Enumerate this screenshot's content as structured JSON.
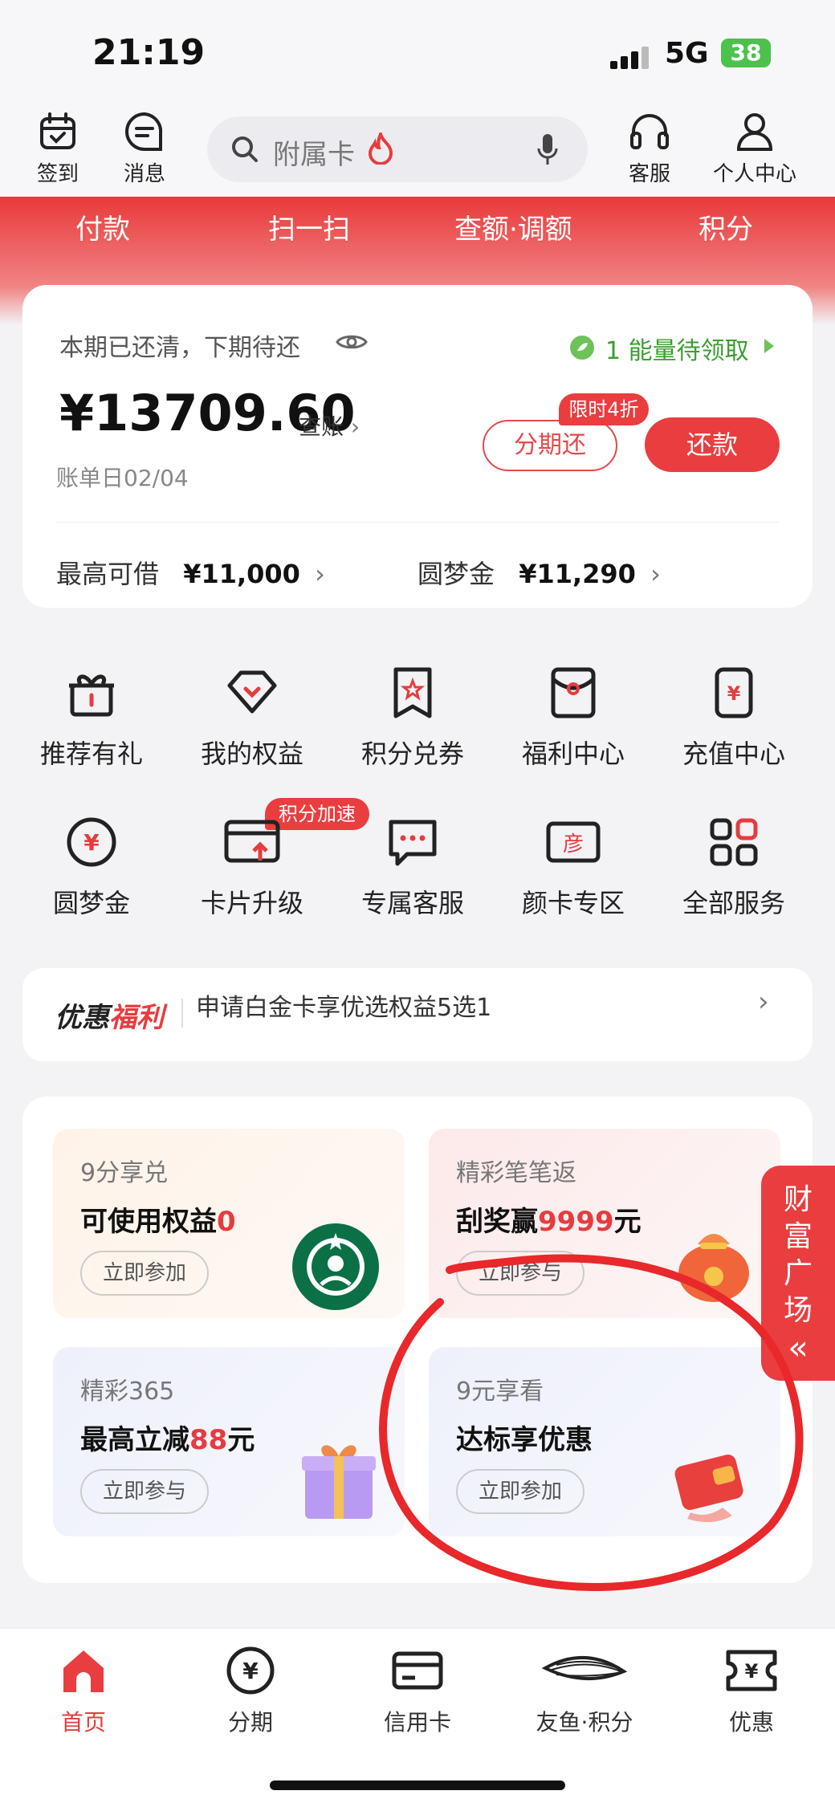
{
  "status_bar": {
    "time": "21:19",
    "network": "5G",
    "battery": "38"
  },
  "header": {
    "checkin_label": "签到",
    "message_label": "消息",
    "search_placeholder": "附属卡",
    "service_label": "客服",
    "profile_label": "个人中心"
  },
  "tabs": [
    "付款",
    "扫一扫",
    "查额·调额",
    "积分"
  ],
  "bill_card": {
    "status": "本期已还清，下期待还",
    "energy": "1 能量待领取",
    "amount": "¥13709.60",
    "view_bill": "查账",
    "bill_date": "账单日02/04",
    "installment_label": "分期还",
    "discount_badge": "限时4折",
    "repay_label": "还款",
    "max_borrow_label": "最高可借",
    "max_borrow_value": "¥11,000",
    "dream_gold_label": "圆梦金",
    "dream_gold_value": "¥11,290"
  },
  "services": [
    {
      "label": "推荐有礼",
      "icon": "gift-icon"
    },
    {
      "label": "我的权益",
      "icon": "rights-icon"
    },
    {
      "label": "积分兑券",
      "icon": "coupon-icon"
    },
    {
      "label": "福利中心",
      "icon": "welfare-icon"
    },
    {
      "label": "充值中心",
      "icon": "recharge-icon"
    },
    {
      "label": "圆梦金",
      "icon": "yen-circle-icon"
    },
    {
      "label": "卡片升级",
      "icon": "card-upgrade-icon"
    },
    {
      "label": "专属客服",
      "icon": "chat-icon"
    },
    {
      "label": "颜卡专区",
      "icon": "yan-card-icon"
    },
    {
      "label": "全部服务",
      "icon": "grid-icon"
    }
  ],
  "speed_badge": "积分加速",
  "promo": {
    "brand_black": "优惠",
    "brand_red": "福利",
    "text": "申请白金卡享优选权益5选1"
  },
  "activities": [
    {
      "sub": "9分享兑",
      "title": "可使用权益",
      "highlight": "0",
      "suffix": "",
      "button": "立即参加"
    },
    {
      "sub": "精彩笔笔返",
      "title": "刮奖赢",
      "highlight": "9999",
      "suffix": "元",
      "button": "立即参与"
    },
    {
      "sub": "精彩365",
      "title": "最高立减",
      "highlight": "88",
      "suffix": "元",
      "button": "立即参与"
    },
    {
      "sub": "9元享看",
      "title": "达标享优惠",
      "highlight": "",
      "suffix": "",
      "button": "立即参加"
    }
  ],
  "wealth_tab": {
    "line1": "财",
    "line2": "富",
    "line3": "广",
    "line4": "场",
    "arrow": "«"
  },
  "bottom_nav": [
    {
      "label": "首页",
      "icon": "home-icon"
    },
    {
      "label": "分期",
      "icon": "installment-icon"
    },
    {
      "label": "信用卡",
      "icon": "credit-card-icon"
    },
    {
      "label": "友鱼·积分",
      "icon": "fish-icon"
    },
    {
      "label": "优惠",
      "icon": "ticket-icon"
    }
  ],
  "colors": {
    "brand_red": "#ea3d3f",
    "energy_green": "#3a9e2e"
  }
}
